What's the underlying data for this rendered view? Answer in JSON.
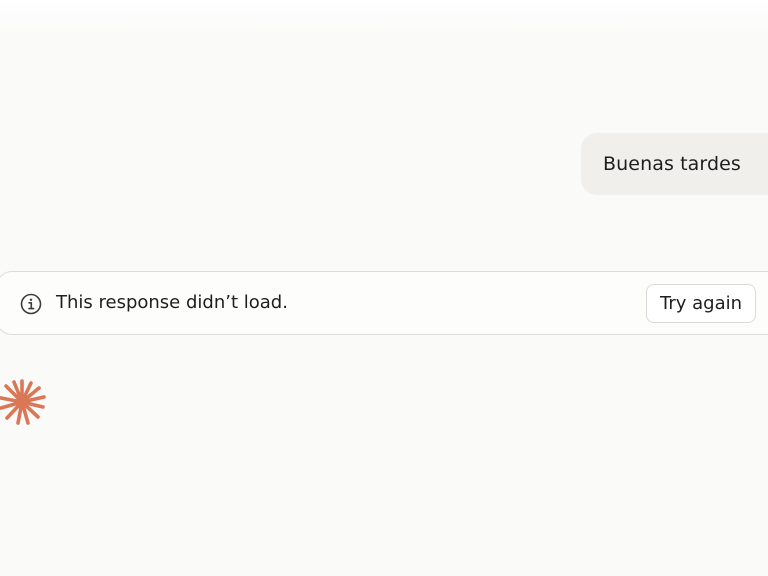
{
  "conversation": {
    "user_message": "Buenas tardes"
  },
  "error_notice": {
    "icon": "info-icon",
    "message": "This response didn’t load.",
    "retry_label": "Try again"
  },
  "assistant": {
    "logo_icon": "spark-icon",
    "logo_color": "#d97757"
  }
}
